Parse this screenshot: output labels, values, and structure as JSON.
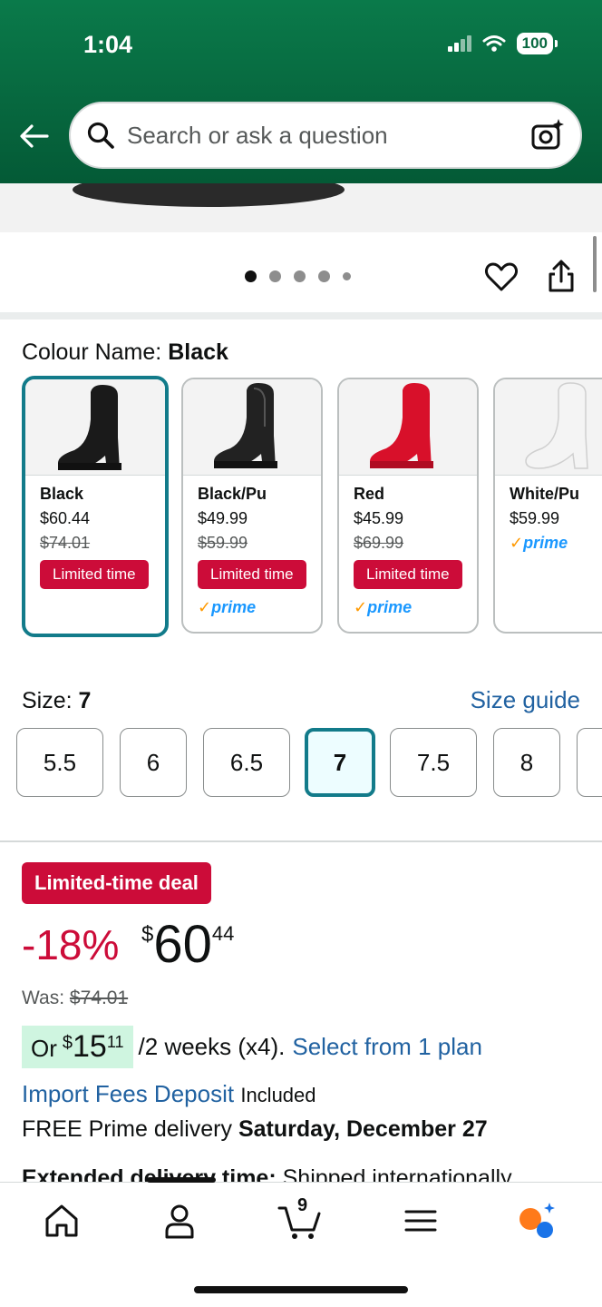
{
  "status_bar": {
    "time": "1:04",
    "battery": "100"
  },
  "search": {
    "placeholder": "Search or ask a question"
  },
  "colour": {
    "label": "Colour Name:",
    "selected": "Black",
    "options": [
      {
        "name": "Black",
        "price": "$60.44",
        "was": "$74.01",
        "badge": "Limited time",
        "prime": ""
      },
      {
        "name": "Black/Pu",
        "price": "$49.99",
        "was": "$59.99",
        "badge": "Limited time",
        "prime": "prime"
      },
      {
        "name": "Red",
        "price": "$45.99",
        "was": "$69.99",
        "badge": "Limited time",
        "prime": "prime"
      },
      {
        "name": "White/Pu",
        "price": "$59.99",
        "was": "",
        "badge": "",
        "prime": "prime"
      }
    ]
  },
  "size": {
    "label": "Size:",
    "selected": "7",
    "guide": "Size guide",
    "options": [
      "5.5",
      "6",
      "6.5",
      "7",
      "7.5",
      "8"
    ]
  },
  "deal": {
    "badge": "Limited-time deal",
    "discount": "-18%",
    "currency": "$",
    "price_whole": "60",
    "price_fraction": "44",
    "was_label": "Was:",
    "was_price": "$74.01"
  },
  "installment": {
    "or": "Or",
    "currency": "$",
    "whole": "15",
    "fraction": "11",
    "period": "/2 weeks (x4).",
    "link": "Select from 1 plan"
  },
  "import_fees": {
    "link": "Import Fees Deposit",
    "status": "Included"
  },
  "delivery": {
    "prefix": "FREE Prime delivery",
    "date": "Saturday, December 27"
  },
  "extended": {
    "label": "Extended delivery time:",
    "text": "Shipped internationally"
  },
  "nav": {
    "cart_count": "9"
  },
  "colors": {
    "header": "#07683f",
    "accent": "#127b8a",
    "deal_red": "#cc0c39",
    "link": "#2162a1"
  }
}
